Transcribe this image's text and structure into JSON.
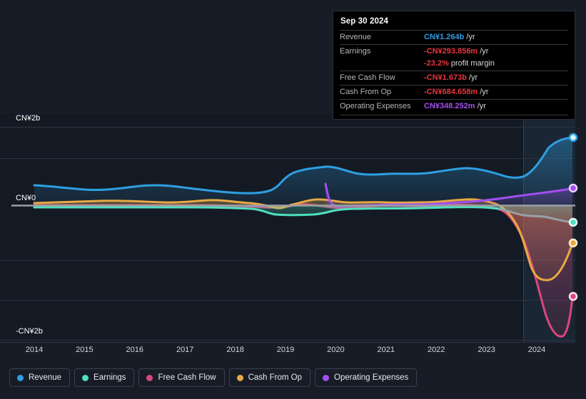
{
  "tooltip": {
    "title": "Sep 30 2024",
    "rows": [
      {
        "label": "Revenue",
        "value": "CN¥1.264b",
        "suffix": "/yr",
        "tone": "rev"
      },
      {
        "label": "Earnings",
        "value": "-CN¥293.856m",
        "suffix": "/yr",
        "tone": "neg"
      },
      {
        "label": "",
        "value": "-23.2%",
        "suffix": "profit margin",
        "tone": "neg"
      },
      {
        "label": "Free Cash Flow",
        "value": "-CN¥1.673b",
        "suffix": "/yr",
        "tone": "neg"
      },
      {
        "label": "Cash From Op",
        "value": "-CN¥684.658m",
        "suffix": "/yr",
        "tone": "neg"
      },
      {
        "label": "Operating Expenses",
        "value": "CN¥348.252m",
        "suffix": "/yr",
        "tone": "opex"
      }
    ]
  },
  "legend": {
    "items": [
      {
        "label": "Revenue",
        "color": "#2f9fe3"
      },
      {
        "label": "Earnings",
        "color": "#4fe0c0"
      },
      {
        "label": "Free Cash Flow",
        "color": "#d9477f"
      },
      {
        "label": "Cash From Op",
        "color": "#e8a945"
      },
      {
        "label": "Operating Expenses",
        "color": "#a34ff0"
      }
    ]
  },
  "chart_data": {
    "type": "line",
    "title": "",
    "xlabel": "",
    "ylabel": "",
    "currency": "CN¥",
    "ylim": [
      -2.4,
      2.4
    ],
    "ytick_labels": [
      "CN¥2b",
      "CN¥0",
      "-CN¥2b"
    ],
    "ytick_values": [
      2,
      0,
      -2
    ],
    "grid": true,
    "legend_position": "bottom",
    "x": [
      2014,
      2015,
      2016,
      2017,
      2018,
      2019,
      2020,
      2021,
      2022,
      2023,
      2024
    ],
    "xtick_labels": [
      "2014",
      "2015",
      "2016",
      "2017",
      "2018",
      "2019",
      "2020",
      "2021",
      "2022",
      "2023",
      "2024"
    ],
    "forecast_start": 2023.6,
    "series": [
      {
        "name": "Revenue",
        "color": "#2f9fe3",
        "end_value": 1.264,
        "values": [
          0.5,
          0.44,
          0.46,
          0.5,
          0.43,
          0.73,
          0.65,
          0.6,
          0.7,
          0.52,
          1.264
        ]
      },
      {
        "name": "Earnings",
        "color": "#4fe0c0",
        "end_value": -0.294,
        "values": [
          0.02,
          0.02,
          0.02,
          0.02,
          0.02,
          -0.21,
          0.02,
          0.02,
          0.02,
          0.0,
          -0.294
        ]
      },
      {
        "name": "Free Cash Flow",
        "color": "#d9477f",
        "end_value": -1.673,
        "values": [
          0.0,
          0.0,
          0.0,
          0.0,
          0.0,
          -0.1,
          -0.05,
          -0.05,
          -0.05,
          -0.1,
          -1.673
        ]
      },
      {
        "name": "Cash From Op",
        "color": "#e8a945",
        "end_value": -0.685,
        "values": [
          0.1,
          0.1,
          0.12,
          0.12,
          0.12,
          0.14,
          0.12,
          0.1,
          0.12,
          0.14,
          -0.685
        ]
      },
      {
        "name": "Operating Expenses",
        "color": "#a34ff0",
        "end_value": 0.348,
        "values": [
          null,
          null,
          null,
          null,
          null,
          null,
          0.03,
          0.04,
          0.05,
          0.09,
          0.348
        ]
      }
    ]
  }
}
